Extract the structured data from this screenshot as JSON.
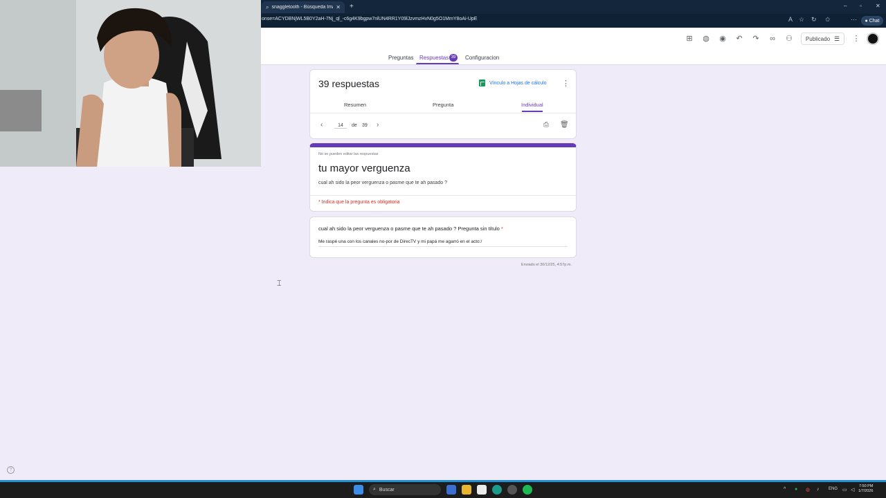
{
  "browser": {
    "tab_title": "snaggletooth - Búsqueda Imágen",
    "url": "onse=ACYDBNjWL5B0Y2aH-7Nj_ql_-c6g4K9bgpw7nlUN4RR1Y09lJzvmzHvN0g5O1MmY8oAi-UpE",
    "chat_label": "Chat"
  },
  "header": {
    "published_label": "Publicado"
  },
  "nav": {
    "questions": "Preguntas",
    "responses": "Respuestas",
    "responses_badge": "39",
    "settings": "Configuracion"
  },
  "summary": {
    "count_label": "39 respuestas",
    "sheets_link": "Vínculo a Hojas de cálculo",
    "tabs": [
      "Resumen",
      "Pregunta",
      "Individual"
    ],
    "active_tab": "Individual",
    "pager": {
      "current": "14",
      "of_label": "de",
      "total": "39"
    }
  },
  "form": {
    "no_edit_note": "No se pueden editar las respuestas",
    "title": "tu mayor verguenza",
    "description": "cual ah sido la peor verguenza o pasme que te ah pasado ?",
    "required_note": "* Indica que la pregunta es obligatoria"
  },
  "answer": {
    "question": "cual ah sido la peor verguenza o pasme que te ah pasado ?  Pregunta sin título",
    "required_mark": "*",
    "response": "Me raspé una con los canales no-por de DirecTV y mi papá me agarró en el acto:/",
    "submitted": "Enviado el 30/12/25, 4:57p.m."
  },
  "taskbar": {
    "search_label": "Buscar",
    "lang": "ENG",
    "time": "7:50 PM",
    "date": "1/7/2026"
  },
  "colors": {
    "accent": "#673ab7",
    "page_bg": "#f0ebf8",
    "required": "#d93025",
    "link": "#1a73e8"
  }
}
